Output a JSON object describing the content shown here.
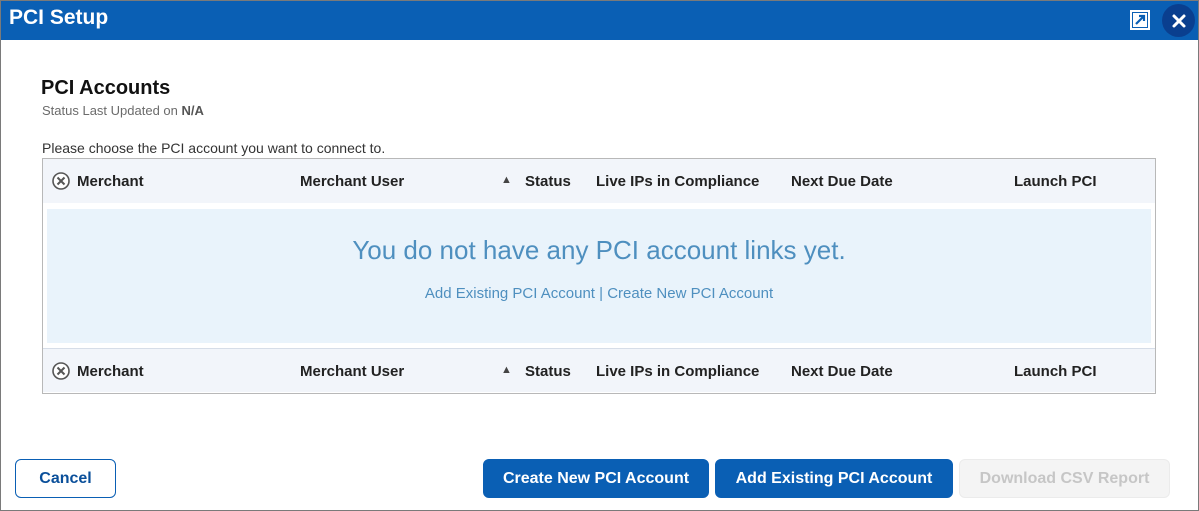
{
  "dialog": {
    "title": "PCI Setup"
  },
  "section": {
    "title": "PCI Accounts",
    "status_prefix": "Status Last Updated on ",
    "status_value": "N/A",
    "instruction": "Please choose the PCI account you want to connect to."
  },
  "table": {
    "columns": {
      "merchant": "Merchant",
      "merchant_user": "Merchant User",
      "sort_indicator": "▲",
      "status": "Status",
      "live_ips": "Live IPs in Compliance",
      "next_due": "Next Due Date",
      "launch": "Launch PCI"
    },
    "empty_message": "You do not have any PCI account links yet.",
    "add_link": "Add Existing PCI Account",
    "separator": " | ",
    "create_link": "Create New PCI Account"
  },
  "buttons": {
    "cancel": "Cancel",
    "create": "Create New PCI Account",
    "add": "Add Existing PCI Account",
    "download": "Download CSV Report"
  },
  "colors": {
    "brand": "#0a5fb4",
    "empty_bg": "#e9f3fb",
    "empty_text": "#4e8fbf"
  },
  "icons": {
    "popout": "popout-icon",
    "close": "close-icon",
    "column_chooser": "column-chooser-icon"
  }
}
